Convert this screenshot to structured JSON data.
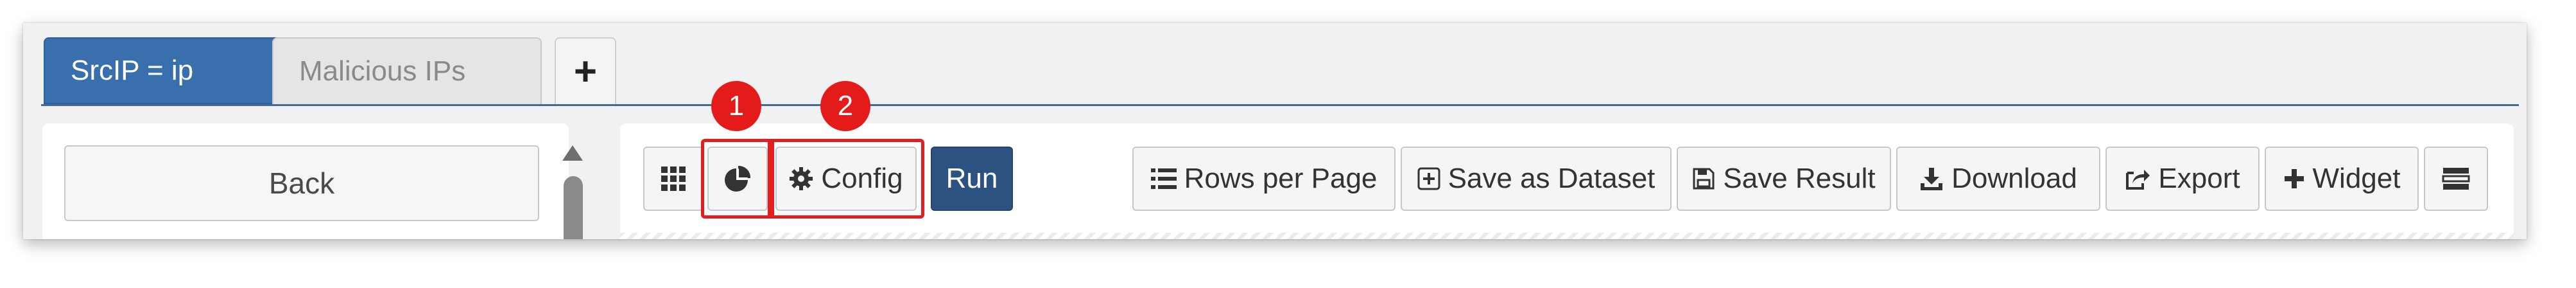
{
  "tabs": [
    {
      "label": "SrcIP = ip",
      "active": true
    },
    {
      "label": "Malicious IPs",
      "active": false
    }
  ],
  "tab_add_label": "+",
  "left_panel": {
    "back_label": "Back"
  },
  "toolbar": {
    "run_label": "Run",
    "config_label": "Config",
    "rows_per_page_label": "Rows per Page",
    "save_dataset_label": "Save as Dataset",
    "save_result_label": "Save Result",
    "download_label": "Download",
    "export_label": "Export",
    "widget_label": "Widget"
  },
  "annotations": [
    {
      "number": "1"
    },
    {
      "number": "2"
    }
  ],
  "colors": {
    "tab_active": "#3a6fad",
    "run_button": "#2c5282",
    "highlight": "#e02020",
    "badge": "#e31b1b"
  },
  "icons": [
    "grid-icon",
    "pie-chart-icon",
    "gear-icon",
    "list-icon",
    "plus-square-icon",
    "save-icon",
    "download-icon",
    "export-icon",
    "plus-icon",
    "panel-icon",
    "scroll-up-icon"
  ]
}
